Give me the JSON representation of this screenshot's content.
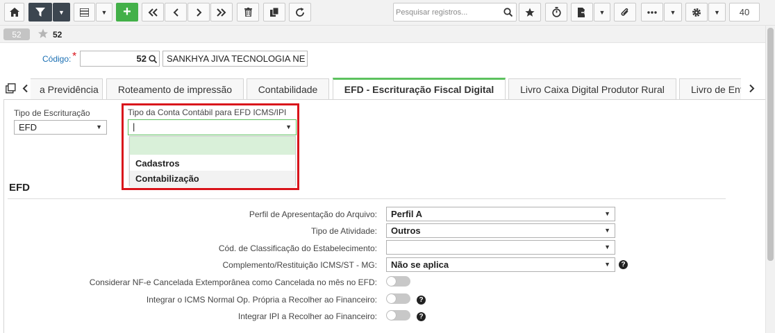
{
  "toolbar": {
    "buttons": [
      {
        "name": "home-button",
        "icon": "home-icon"
      },
      {
        "name": "filter-button",
        "icon": "filter-icon"
      },
      {
        "name": "grid-view-button",
        "icon": "grid-icon"
      },
      {
        "name": "add-button",
        "icon": "plus-icon",
        "glyph": "+"
      },
      {
        "name": "first-record-button",
        "icon": "double-chevron-left-icon"
      },
      {
        "name": "previous-record-button",
        "icon": "chevron-left-icon"
      },
      {
        "name": "next-record-button",
        "icon": "chevron-right-icon"
      },
      {
        "name": "last-record-button",
        "icon": "double-chevron-right-icon"
      },
      {
        "name": "delete-button",
        "icon": "trash-icon"
      },
      {
        "name": "copy-button",
        "icon": "copy-icon"
      },
      {
        "name": "refresh-button",
        "icon": "refresh-icon"
      },
      {
        "name": "favorite-button",
        "icon": "star-icon"
      },
      {
        "name": "timer-button",
        "icon": "stopwatch-icon"
      },
      {
        "name": "export-button",
        "icon": "file-export-icon"
      },
      {
        "name": "attach-button",
        "icon": "paperclip-icon"
      },
      {
        "name": "more-button",
        "icon": "ellipsis-icon"
      },
      {
        "name": "settings-button",
        "icon": "gear-icon"
      }
    ],
    "search_placeholder": "Pesquisar registros...",
    "page_size": "40"
  },
  "breadcrumb": {
    "badge": "52",
    "title": "52"
  },
  "header": {
    "code_label": "Código:",
    "required_mark": "*",
    "code_value": "52",
    "company_name": "SANKHYA JIVA TECNOLOGIA NE"
  },
  "tabs": [
    {
      "label": "a Previdência",
      "active": false
    },
    {
      "label": "Roteamento de impressão",
      "active": false
    },
    {
      "label": "Contabilidade",
      "active": false
    },
    {
      "label": "EFD - Escrituração Fiscal Digital",
      "active": true
    },
    {
      "label": "Livro Caixa Digital Produtor Rural",
      "active": false
    },
    {
      "label": "Livro de Ent",
      "active": false
    }
  ],
  "fields": {
    "tipo_escrituracao": {
      "label": "Tipo de Escrituração",
      "value": "EFD"
    },
    "tipo_conta": {
      "label": "Tipo da Conta Contábil para EFD ICMS/IPI",
      "value": "|",
      "options": [
        "",
        "Cadastros",
        "Contabilização"
      ]
    }
  },
  "section_title": "EFD",
  "efd_rows": [
    {
      "label": "Perfil de Apresentação do Arquivo:",
      "type": "select",
      "value": "Perfil A",
      "help": false
    },
    {
      "label": "Tipo de Atividade:",
      "type": "select",
      "value": "Outros",
      "help": false
    },
    {
      "label": "Cód. de Classificação do Estabelecimento:",
      "type": "select",
      "value": "",
      "help": false
    },
    {
      "label": "Complemento/Restituição ICMS/ST - MG:",
      "type": "select",
      "value": "Não se aplica",
      "help": true
    },
    {
      "label": "Considerar NF-e Cancelada Extemporânea como Cancelada no mês no EFD:",
      "type": "toggle",
      "on": false,
      "help": false
    },
    {
      "label": "Integrar o ICMS Normal Op. Própria a Recolher ao Financeiro:",
      "type": "toggle",
      "on": false,
      "help": true
    },
    {
      "label": "Integrar IPI a Recolher ao Financeiro:",
      "type": "toggle",
      "on": false,
      "help": true
    }
  ],
  "help_glyph": "?",
  "colors": {
    "accent_green": "#43b049",
    "active_tab_border": "#5cc25e",
    "highlight_border": "#d9141b",
    "dropdown_selected": "#d9f0d9",
    "link_blue": "#1a6fb3"
  }
}
